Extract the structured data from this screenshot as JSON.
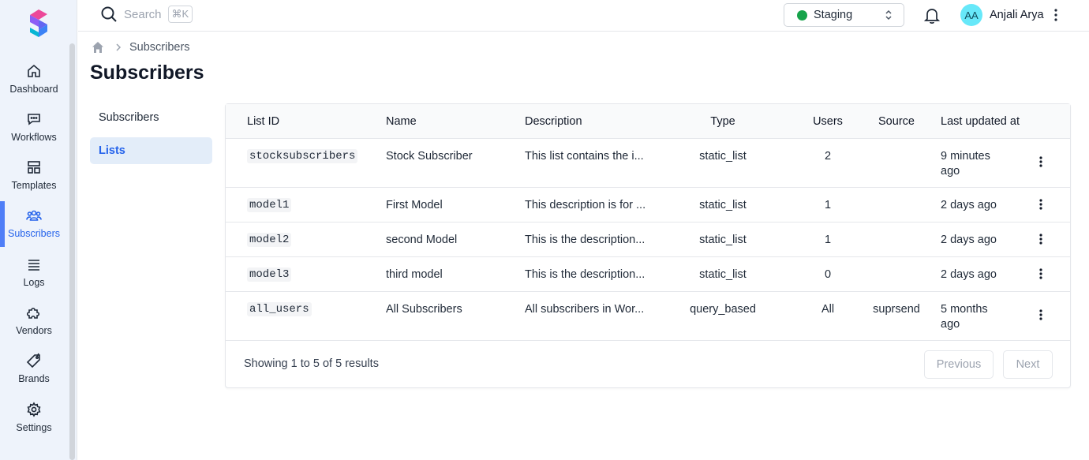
{
  "brand": {
    "accent": "#4f7ef7",
    "logo_icon": "suprsend-logo-icon"
  },
  "sidebar": {
    "items": [
      {
        "label": "Dashboard",
        "icon": "home-icon"
      },
      {
        "label": "Workflows",
        "icon": "message-icon"
      },
      {
        "label": "Templates",
        "icon": "layout-icon"
      },
      {
        "label": "Subscribers",
        "icon": "users-icon",
        "active": true
      },
      {
        "label": "Logs",
        "icon": "list-icon"
      },
      {
        "label": "Vendors",
        "icon": "puzzle-icon"
      },
      {
        "label": "Brands",
        "icon": "tag-icon"
      },
      {
        "label": "Settings",
        "icon": "gear-icon"
      }
    ]
  },
  "topbar": {
    "search_placeholder": "Search",
    "search_shortcut": "⌘K",
    "environment": "Staging",
    "environment_color": "#16a34a",
    "user_initials": "AA",
    "user_name": "Anjali Arya"
  },
  "breadcrumb": {
    "current": "Subscribers"
  },
  "page": {
    "title": "Subscribers"
  },
  "subnav": {
    "items": [
      {
        "label": "Subscribers"
      },
      {
        "label": "Lists",
        "active": true
      }
    ]
  },
  "table": {
    "headers": {
      "list_id": "List ID",
      "name": "Name",
      "description": "Description",
      "type": "Type",
      "users": "Users",
      "source": "Source",
      "updated": "Last updated at"
    },
    "rows": [
      {
        "list_id": "stocksubscribers",
        "name": "Stock Subscriber",
        "description": "This list contains the i...",
        "type": "static_list",
        "users": "2",
        "source": "",
        "updated_line1": "9 minutes",
        "updated_line2": "ago"
      },
      {
        "list_id": "model1",
        "name": "First Model",
        "description": "This description is for ...",
        "type": "static_list",
        "users": "1",
        "source": "",
        "updated_line1": "2 days ago",
        "updated_line2": ""
      },
      {
        "list_id": "model2",
        "name": "second Model",
        "description": "This is the description...",
        "type": "static_list",
        "users": "1",
        "source": "",
        "updated_line1": "2 days ago",
        "updated_line2": ""
      },
      {
        "list_id": "model3",
        "name": "third model",
        "description": "This is the description...",
        "type": "static_list",
        "users": "0",
        "source": "",
        "updated_line1": "2 days ago",
        "updated_line2": ""
      },
      {
        "list_id": "all_users",
        "name": "All Subscribers",
        "description": "All subscribers in Wor...",
        "type": "query_based",
        "users": "All",
        "source": "suprsend",
        "updated_line1": "5 months",
        "updated_line2": "ago"
      }
    ],
    "footer": {
      "prefix": "Showing ",
      "from": "1",
      "to_word": " to ",
      "to": "5",
      "of_word": " of ",
      "total": "5",
      "suffix": " results"
    },
    "pagination": {
      "previous": "Previous",
      "next": "Next"
    }
  }
}
